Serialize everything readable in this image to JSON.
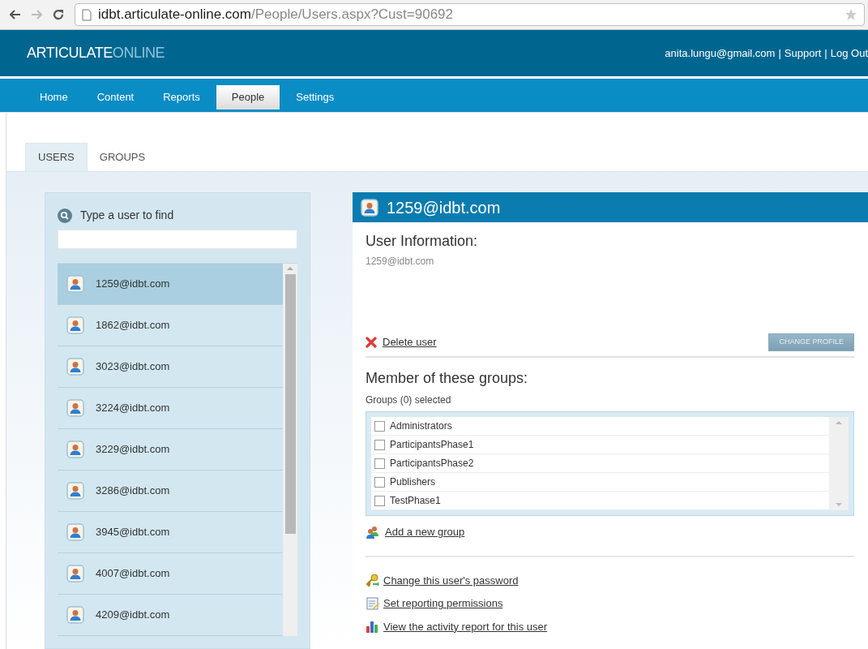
{
  "browser": {
    "url_host": "idbt.articulate-online.com",
    "url_path": "/People/Users.aspx?Cust=90692"
  },
  "header": {
    "logo": {
      "primary": "ARTICULATE",
      "secondary": "ONLINE"
    },
    "links": [
      "anita.lungu@gmail.com",
      "Support",
      "Log Out"
    ],
    "separators": [
      "|",
      "|"
    ]
  },
  "nav": [
    {
      "label": "Home",
      "selected": false
    },
    {
      "label": "Content",
      "selected": false
    },
    {
      "label": "Reports",
      "selected": false
    },
    {
      "label": "People",
      "selected": true
    },
    {
      "label": "Settings",
      "selected": false
    }
  ],
  "tabs": [
    {
      "label": "USERS",
      "selected": true
    },
    {
      "label": "GROUPS",
      "selected": false
    }
  ],
  "search": {
    "label": "Type a user to find"
  },
  "users": [
    {
      "email": "1259@idbt.com",
      "selected": true
    },
    {
      "email": "1862@idbt.com",
      "selected": false
    },
    {
      "email": "3023@idbt.com",
      "selected": false
    },
    {
      "email": "3224@idbt.com",
      "selected": false
    },
    {
      "email": "3229@idbt.com",
      "selected": false
    },
    {
      "email": "3286@idbt.com",
      "selected": false
    },
    {
      "email": "3945@idbt.com",
      "selected": false
    },
    {
      "email": "4007@idbt.com",
      "selected": false
    },
    {
      "email": "4209@idbt.com",
      "selected": false
    }
  ],
  "detail": {
    "title": "1259@idbt.com",
    "info_heading": "User Information:",
    "info_value": "1259@idbt.com",
    "delete_link": "Delete user",
    "change_profile": "CHANGE PROFILE",
    "groups_heading": "Member of these groups:",
    "groups_count": "Groups (0) selected",
    "groups": [
      {
        "name": "Administrators",
        "checked": false
      },
      {
        "name": "ParticipantsPhase1",
        "checked": false
      },
      {
        "name": "ParticipantsPhase2",
        "checked": false
      },
      {
        "name": "Publishers",
        "checked": false
      },
      {
        "name": "TestPhase1",
        "checked": false
      }
    ],
    "add_group": "Add a new group",
    "actions": [
      {
        "kind": "password",
        "text": "Change this user's password"
      },
      {
        "kind": "permissions",
        "text": "Set reporting permissions"
      },
      {
        "kind": "report",
        "text": "View the activity report for this user"
      }
    ]
  }
}
